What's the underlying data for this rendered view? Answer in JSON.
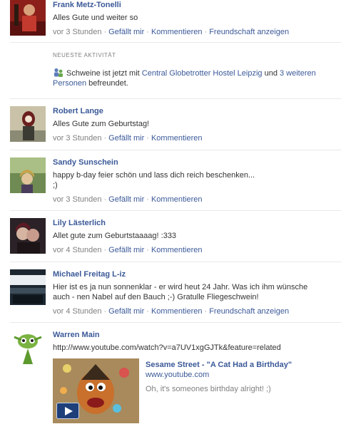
{
  "feed": {
    "posts": [
      {
        "name": "Frank Metz-Tonelli",
        "message": "Alles Gute und weiter so",
        "time": "vor 3 Stunden",
        "actions": [
          "Gefällt mir",
          "Kommentieren",
          "Freundschaft anzeigen"
        ]
      },
      {
        "name": "Robert Lange",
        "message": "Alles Gute zum Geburtstag!",
        "time": "vor 3 Stunden",
        "actions": [
          "Gefällt mir",
          "Kommentieren"
        ]
      },
      {
        "name": "Sandy Sunschein",
        "message": "happy b-day feier schön und lass dich reich beschenken...\n;)",
        "time": "vor 3 Stunden",
        "actions": [
          "Gefällt mir",
          "Kommentieren"
        ]
      },
      {
        "name": "Lily Lästerlich",
        "message": "Allet gute zum Geburtstaaaag! :333",
        "time": "vor 4 Stunden",
        "actions": [
          "Gefällt mir",
          "Kommentieren"
        ]
      },
      {
        "name": "Michael Freitag L-iz",
        "message": "Hier ist es ja nun sonnenklar - er wird heut 24 Jahr. Was ich ihm wünsche\nauch - nen Nabel auf den Bauch ;-) Gratulle Fliegeschwein!",
        "time": "vor 4 Stunden",
        "actions": [
          "Gefällt mir",
          "Kommentieren",
          "Freundschaft anzeigen"
        ]
      },
      {
        "name": "Warren Main",
        "link": "http://www.youtube.com/watch?v=a7UV1xgGJTk&feature=related",
        "attachment": {
          "title": "Sesame Street - \"A Cat Had a Birthday\"",
          "source": "www.youtube.com",
          "description": "Oh, it's someones birthday alright! ;)"
        }
      }
    ]
  },
  "activity": {
    "heading": "NEUESTE AKTIVITÄT",
    "text_prefix": "Schweine ist jetzt mit",
    "link1": "Central Globetrotter Hostel Leipzig",
    "text_mid": "und",
    "link2": "3 weiteren Personen",
    "text_suffix": "befreundet.",
    "icon": "friends-icon"
  },
  "colors": {
    "link": "#3b5998",
    "meta": "#808080",
    "divider": "#e9e9e9"
  }
}
